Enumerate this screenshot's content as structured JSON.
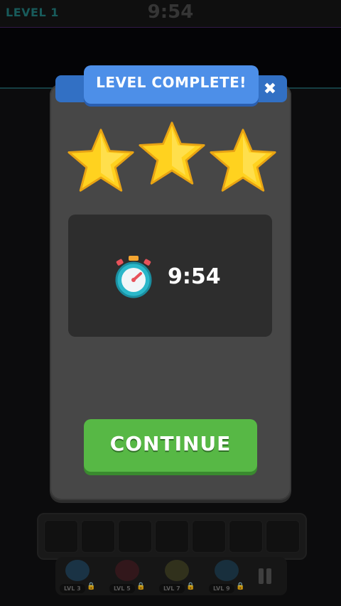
{
  "hud": {
    "level_label": "LEVEL 1",
    "timer": "9:54"
  },
  "modal": {
    "title": "LEVEL COMPLETE!",
    "close_icon": "close-icon",
    "stars_earned": 3,
    "stars_total": 3,
    "time_label": "9:54",
    "continue_label": "CONTINUE"
  },
  "tray": {
    "slot_count": 7
  },
  "powerups": [
    {
      "label": "LVL 3",
      "icon": "rocket-icon"
    },
    {
      "label": "LVL 5",
      "icon": "bomb-icon"
    },
    {
      "label": "LVL 7",
      "icon": "propeller-icon"
    },
    {
      "label": "LVL 9",
      "icon": "freeze-icon"
    }
  ],
  "colors": {
    "banner": "#4d8fe8",
    "continue": "#57b845",
    "star": "#ffd21f",
    "modal": "#474747"
  }
}
